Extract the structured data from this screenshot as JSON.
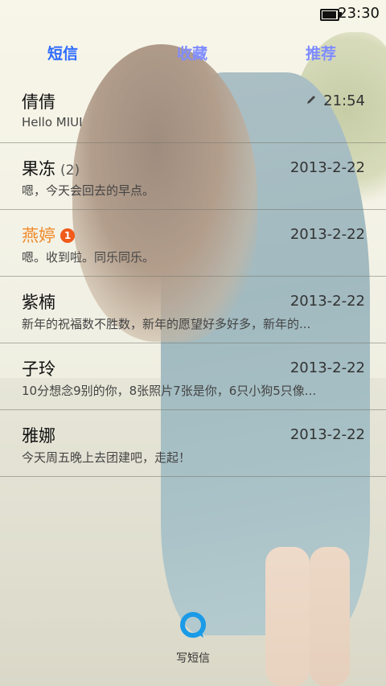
{
  "status_bar": {
    "time": "23:30"
  },
  "tabs": [
    {
      "label": "短信"
    },
    {
      "label": "收藏"
    },
    {
      "label": "推荐"
    }
  ],
  "conversations": [
    {
      "name": "倩倩",
      "count": "",
      "unread_badge": "",
      "date": "21:54",
      "preview": "Hello MIUI",
      "draft": true
    },
    {
      "name": "果冻",
      "count": "(2)",
      "unread_badge": "",
      "date": "2013-2-22",
      "preview": "嗯，今天会回去的早点。"
    },
    {
      "name": "燕婷",
      "count": "",
      "unread_badge": "1",
      "date": "2013-2-22",
      "preview": "嗯。收到啦。同乐同乐。"
    },
    {
      "name": "紫楠",
      "count": "",
      "unread_badge": "",
      "date": "2013-2-22",
      "preview": "新年的祝福数不胜数，新年的愿望好多好多，新年的..."
    },
    {
      "name": "子玲",
      "count": "",
      "unread_badge": "",
      "date": "2013-2-22",
      "preview": "10分想念9别的你，8张照片7张是你，6只小狗5只像..."
    },
    {
      "name": "雅娜",
      "count": "",
      "unread_badge": "",
      "date": "2013-2-22",
      "preview": "今天周五晚上去团建吧，走起！"
    }
  ],
  "compose": {
    "label": "写短信",
    "icon": "chat-bubble-icon"
  },
  "colors": {
    "tab_active": "#2f6bff",
    "tab_inactive": "#7f8cff",
    "unread_name": "#f08a2a",
    "badge": "#f05a1a",
    "compose_icon": "#1a9be8"
  }
}
